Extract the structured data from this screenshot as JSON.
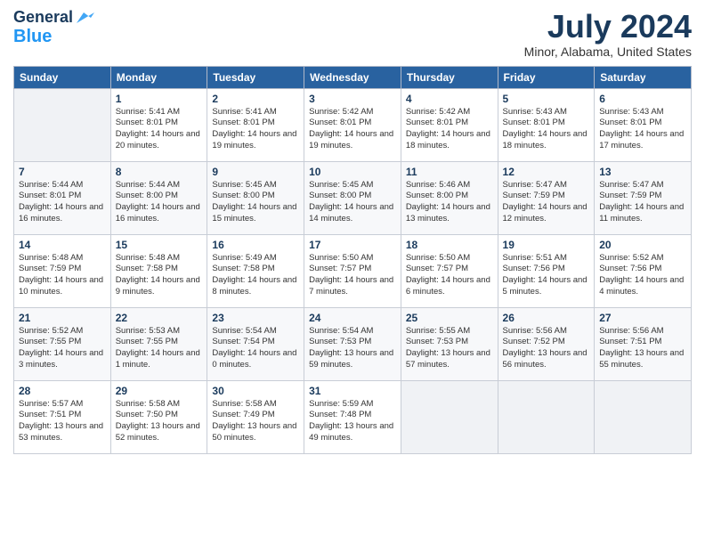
{
  "header": {
    "logo_line1": "General",
    "logo_line2": "Blue",
    "month_title": "July 2024",
    "location": "Minor, Alabama, United States"
  },
  "days_of_week": [
    "Sunday",
    "Monday",
    "Tuesday",
    "Wednesday",
    "Thursday",
    "Friday",
    "Saturday"
  ],
  "weeks": [
    [
      {
        "day": "",
        "empty": true
      },
      {
        "day": "1",
        "sunrise": "Sunrise: 5:41 AM",
        "sunset": "Sunset: 8:01 PM",
        "daylight": "Daylight: 14 hours and 20 minutes."
      },
      {
        "day": "2",
        "sunrise": "Sunrise: 5:41 AM",
        "sunset": "Sunset: 8:01 PM",
        "daylight": "Daylight: 14 hours and 19 minutes."
      },
      {
        "day": "3",
        "sunrise": "Sunrise: 5:42 AM",
        "sunset": "Sunset: 8:01 PM",
        "daylight": "Daylight: 14 hours and 19 minutes."
      },
      {
        "day": "4",
        "sunrise": "Sunrise: 5:42 AM",
        "sunset": "Sunset: 8:01 PM",
        "daylight": "Daylight: 14 hours and 18 minutes."
      },
      {
        "day": "5",
        "sunrise": "Sunrise: 5:43 AM",
        "sunset": "Sunset: 8:01 PM",
        "daylight": "Daylight: 14 hours and 18 minutes."
      },
      {
        "day": "6",
        "sunrise": "Sunrise: 5:43 AM",
        "sunset": "Sunset: 8:01 PM",
        "daylight": "Daylight: 14 hours and 17 minutes."
      }
    ],
    [
      {
        "day": "7",
        "sunrise": "Sunrise: 5:44 AM",
        "sunset": "Sunset: 8:01 PM",
        "daylight": "Daylight: 14 hours and 16 minutes."
      },
      {
        "day": "8",
        "sunrise": "Sunrise: 5:44 AM",
        "sunset": "Sunset: 8:00 PM",
        "daylight": "Daylight: 14 hours and 16 minutes."
      },
      {
        "day": "9",
        "sunrise": "Sunrise: 5:45 AM",
        "sunset": "Sunset: 8:00 PM",
        "daylight": "Daylight: 14 hours and 15 minutes."
      },
      {
        "day": "10",
        "sunrise": "Sunrise: 5:45 AM",
        "sunset": "Sunset: 8:00 PM",
        "daylight": "Daylight: 14 hours and 14 minutes."
      },
      {
        "day": "11",
        "sunrise": "Sunrise: 5:46 AM",
        "sunset": "Sunset: 8:00 PM",
        "daylight": "Daylight: 14 hours and 13 minutes."
      },
      {
        "day": "12",
        "sunrise": "Sunrise: 5:47 AM",
        "sunset": "Sunset: 7:59 PM",
        "daylight": "Daylight: 14 hours and 12 minutes."
      },
      {
        "day": "13",
        "sunrise": "Sunrise: 5:47 AM",
        "sunset": "Sunset: 7:59 PM",
        "daylight": "Daylight: 14 hours and 11 minutes."
      }
    ],
    [
      {
        "day": "14",
        "sunrise": "Sunrise: 5:48 AM",
        "sunset": "Sunset: 7:59 PM",
        "daylight": "Daylight: 14 hours and 10 minutes."
      },
      {
        "day": "15",
        "sunrise": "Sunrise: 5:48 AM",
        "sunset": "Sunset: 7:58 PM",
        "daylight": "Daylight: 14 hours and 9 minutes."
      },
      {
        "day": "16",
        "sunrise": "Sunrise: 5:49 AM",
        "sunset": "Sunset: 7:58 PM",
        "daylight": "Daylight: 14 hours and 8 minutes."
      },
      {
        "day": "17",
        "sunrise": "Sunrise: 5:50 AM",
        "sunset": "Sunset: 7:57 PM",
        "daylight": "Daylight: 14 hours and 7 minutes."
      },
      {
        "day": "18",
        "sunrise": "Sunrise: 5:50 AM",
        "sunset": "Sunset: 7:57 PM",
        "daylight": "Daylight: 14 hours and 6 minutes."
      },
      {
        "day": "19",
        "sunrise": "Sunrise: 5:51 AM",
        "sunset": "Sunset: 7:56 PM",
        "daylight": "Daylight: 14 hours and 5 minutes."
      },
      {
        "day": "20",
        "sunrise": "Sunrise: 5:52 AM",
        "sunset": "Sunset: 7:56 PM",
        "daylight": "Daylight: 14 hours and 4 minutes."
      }
    ],
    [
      {
        "day": "21",
        "sunrise": "Sunrise: 5:52 AM",
        "sunset": "Sunset: 7:55 PM",
        "daylight": "Daylight: 14 hours and 3 minutes."
      },
      {
        "day": "22",
        "sunrise": "Sunrise: 5:53 AM",
        "sunset": "Sunset: 7:55 PM",
        "daylight": "Daylight: 14 hours and 1 minute."
      },
      {
        "day": "23",
        "sunrise": "Sunrise: 5:54 AM",
        "sunset": "Sunset: 7:54 PM",
        "daylight": "Daylight: 14 hours and 0 minutes."
      },
      {
        "day": "24",
        "sunrise": "Sunrise: 5:54 AM",
        "sunset": "Sunset: 7:53 PM",
        "daylight": "Daylight: 13 hours and 59 minutes."
      },
      {
        "day": "25",
        "sunrise": "Sunrise: 5:55 AM",
        "sunset": "Sunset: 7:53 PM",
        "daylight": "Daylight: 13 hours and 57 minutes."
      },
      {
        "day": "26",
        "sunrise": "Sunrise: 5:56 AM",
        "sunset": "Sunset: 7:52 PM",
        "daylight": "Daylight: 13 hours and 56 minutes."
      },
      {
        "day": "27",
        "sunrise": "Sunrise: 5:56 AM",
        "sunset": "Sunset: 7:51 PM",
        "daylight": "Daylight: 13 hours and 55 minutes."
      }
    ],
    [
      {
        "day": "28",
        "sunrise": "Sunrise: 5:57 AM",
        "sunset": "Sunset: 7:51 PM",
        "daylight": "Daylight: 13 hours and 53 minutes."
      },
      {
        "day": "29",
        "sunrise": "Sunrise: 5:58 AM",
        "sunset": "Sunset: 7:50 PM",
        "daylight": "Daylight: 13 hours and 52 minutes."
      },
      {
        "day": "30",
        "sunrise": "Sunrise: 5:58 AM",
        "sunset": "Sunset: 7:49 PM",
        "daylight": "Daylight: 13 hours and 50 minutes."
      },
      {
        "day": "31",
        "sunrise": "Sunrise: 5:59 AM",
        "sunset": "Sunset: 7:48 PM",
        "daylight": "Daylight: 13 hours and 49 minutes."
      },
      {
        "day": "",
        "empty": true
      },
      {
        "day": "",
        "empty": true
      },
      {
        "day": "",
        "empty": true
      }
    ]
  ]
}
